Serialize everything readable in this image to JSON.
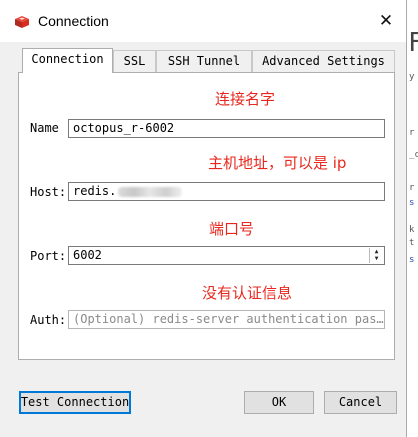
{
  "window": {
    "title": "Connection"
  },
  "background_app": {
    "glyphs": [
      "F",
      "y",
      "r",
      "_c",
      "r",
      "s",
      "k",
      "t",
      "s"
    ]
  },
  "tabs": [
    {
      "label": "Connection",
      "active": true
    },
    {
      "label": "SSL",
      "active": false
    },
    {
      "label": "SSH Tunnel",
      "active": false
    },
    {
      "label": "Advanced Settings",
      "active": false
    }
  ],
  "annotations": {
    "name": "连接名字",
    "host": "主机地址，可以是 ip",
    "port": "端口号",
    "auth": "没有认证信息"
  },
  "form": {
    "name_label": "Name",
    "name_value": "octopus_r-6002",
    "host_label": "Host:",
    "host_value": "redis.",
    "port_label": "Port:",
    "port_value": "6002",
    "auth_label": "Auth:",
    "auth_placeholder": "(Optional) redis-server authentication pas…"
  },
  "buttons": {
    "test": "Test Connection",
    "ok": "OK",
    "cancel": "Cancel"
  },
  "colors": {
    "annotation": "#e8281e",
    "accent_focus": "#0078d7",
    "app_icon": "#d82c20"
  }
}
